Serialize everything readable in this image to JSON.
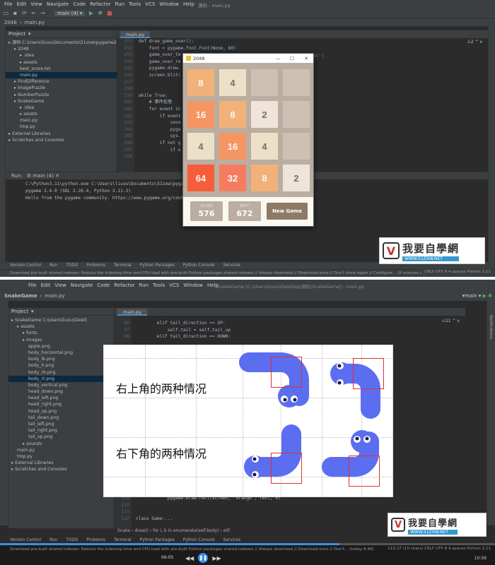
{
  "top_ide": {
    "menu": [
      "File",
      "Edit",
      "View",
      "Navigate",
      "Code",
      "Refactor",
      "Run",
      "Tools",
      "VCS",
      "Window",
      "Help"
    ],
    "window_title": "源码 - main.py",
    "run_config": "main (4)",
    "breadcrumb": [
      "2048",
      "main.py"
    ],
    "project_label": "Project",
    "editor_tab": "main.py",
    "tree": [
      {
        "text": "源码 C:\\Users\\liuxu\\Documents\\51zxw\\pygame2\\源码",
        "indent": 0
      },
      {
        "text": "2048",
        "indent": 1
      },
      {
        "text": ".idea",
        "indent": 2
      },
      {
        "text": "assets",
        "indent": 2
      },
      {
        "text": "best_score.txt",
        "indent": 2
      },
      {
        "text": "main.py",
        "indent": 2,
        "selected": true
      },
      {
        "text": "FindDifference",
        "indent": 1
      },
      {
        "text": "ImagePuzzle",
        "indent": 1
      },
      {
        "text": "NumberPuzzle",
        "indent": 1
      },
      {
        "text": "SnakeGame",
        "indent": 1
      },
      {
        "text": ".idea",
        "indent": 2
      },
      {
        "text": "assets",
        "indent": 2
      },
      {
        "text": "main.py",
        "indent": 2
      },
      {
        "text": "tmp.py",
        "indent": 2
      },
      {
        "text": "External Libraries",
        "indent": 0
      },
      {
        "text": "Scratches and Consoles",
        "indent": 0
      }
    ],
    "gutter": [
      "251",
      "252",
      "253",
      "254",
      "255",
      "256",
      "257",
      "258",
      "259",
      "260",
      "261",
      "262",
      "263",
      "264",
      "265",
      "266",
      "267",
      "268"
    ],
    "code": [
      "def draw_game_over():",
      "    font = pygame.font.Font(None, 60)",
      "    game_over_te",
      "    game_over_re",
      "    pygame.draw.",
      "    screen.blit(",
      "",
      "",
      "while True:",
      "    # 事件处理",
      "    for event in",
      "        if event",
      "            save",
      "            pyga",
      "            sys.",
      "        if not g",
      "            if e",
      ""
    ],
    "code_right_fragment": "Text')",
    "warning_badge": "⚠2 ^ v",
    "run_label": "Run:",
    "run_tab": "main (4)",
    "console": [
      "C:\\Python3.11\\python.exe C:\\Users\\liuxu\\Documents\\51zxw\\pyga",
      "pygame 2.4.0 (SDL 2.26.4, Python 3.11.3)",
      "Hello from the pygame community. https://www.pygame.org/cont"
    ],
    "console_link": "https://www.pygame.org/cont",
    "bottom_tabs": [
      "Version Control",
      "Run",
      "TODO",
      "Problems",
      "Terminal",
      "Python Packages",
      "Python Console",
      "Services"
    ],
    "status": "Download pre-built shared indexes: Reduce the indexing time and CPU load with pre-built Python packages shared indexes // Always download // Download once // Don't show again // Configure... (8 minutes ag",
    "status_right": "CRLF  UTF-8  4 spaces  Python 3.11"
  },
  "game2048": {
    "title": "2048",
    "tiles": [
      {
        "v": "8",
        "row": 0,
        "col": 0,
        "bg": "#f2b179",
        "fg": "#f9f6f2"
      },
      {
        "v": "4",
        "row": 0,
        "col": 1,
        "bg": "#ede0c8",
        "fg": "#776e65"
      },
      {
        "v": "",
        "row": 0,
        "col": 2,
        "bg": "#cdc1b4",
        "fg": "#776e65"
      },
      {
        "v": "",
        "row": 0,
        "col": 3,
        "bg": "#cdc1b4",
        "fg": "#776e65"
      },
      {
        "v": "16",
        "row": 1,
        "col": 0,
        "bg": "#f59563",
        "fg": "#f9f6f2"
      },
      {
        "v": "8",
        "row": 1,
        "col": 1,
        "bg": "#f2b179",
        "fg": "#f9f6f2"
      },
      {
        "v": "2",
        "row": 1,
        "col": 2,
        "bg": "#eee4da",
        "fg": "#776e65"
      },
      {
        "v": "",
        "row": 1,
        "col": 3,
        "bg": "#cdc1b4",
        "fg": "#776e65"
      },
      {
        "v": "4",
        "row": 2,
        "col": 0,
        "bg": "#ede0c8",
        "fg": "#776e65"
      },
      {
        "v": "16",
        "row": 2,
        "col": 1,
        "bg": "#f59563",
        "fg": "#f9f6f2"
      },
      {
        "v": "4",
        "row": 2,
        "col": 2,
        "bg": "#ede0c8",
        "fg": "#776e65"
      },
      {
        "v": "",
        "row": 2,
        "col": 3,
        "bg": "#cdc1b4",
        "fg": "#776e65"
      },
      {
        "v": "64",
        "row": 3,
        "col": 0,
        "bg": "#f65e3b",
        "fg": "#f9f6f2"
      },
      {
        "v": "32",
        "row": 3,
        "col": 1,
        "bg": "#f67c5f",
        "fg": "#f9f6f2"
      },
      {
        "v": "8",
        "row": 3,
        "col": 2,
        "bg": "#f2b179",
        "fg": "#f9f6f2"
      },
      {
        "v": "2",
        "row": 3,
        "col": 3,
        "bg": "#eee4da",
        "fg": "#776e65"
      }
    ],
    "score_label": "SCORE",
    "score": "576",
    "best_label": "BEST",
    "best": "672",
    "new_game": "New Game"
  },
  "watermark": {
    "title": "我要自學網",
    "url": "WWW.51ZXW.NET"
  },
  "bottom_ide": {
    "window_title": "SnakeGame [C:\\Users\\liuxu\\Desktop\\源码\\SnakeGame] - main.py",
    "project_crumb": [
      "SnakeGame",
      "main.py"
    ],
    "run_config": "main",
    "project_label": "Project",
    "editor_tab": "main.py",
    "tree": [
      {
        "text": "SnakeGame C:\\Users\\liuxu\\Deskt",
        "indent": 0
      },
      {
        "text": "assets",
        "indent": 1
      },
      {
        "text": "fonts",
        "indent": 2
      },
      {
        "text": "images",
        "indent": 2
      },
      {
        "text": "apple.png",
        "indent": 3
      },
      {
        "text": "body_horizontal.png",
        "indent": 3
      },
      {
        "text": "body_lb.png",
        "indent": 3
      },
      {
        "text": "body_lt.png",
        "indent": 3
      },
      {
        "text": "body_rb.png",
        "indent": 3
      },
      {
        "text": "body_rt.png",
        "indent": 3,
        "selected": true
      },
      {
        "text": "body_vertical.png",
        "indent": 3
      },
      {
        "text": "head_down.png",
        "indent": 3
      },
      {
        "text": "head_left.png",
        "indent": 3
      },
      {
        "text": "head_right.png",
        "indent": 3
      },
      {
        "text": "head_up.png",
        "indent": 3
      },
      {
        "text": "tail_down.png",
        "indent": 3
      },
      {
        "text": "tail_left.png",
        "indent": 3
      },
      {
        "text": "tail_right.png",
        "indent": 3
      },
      {
        "text": "tail_up.png",
        "indent": 3
      },
      {
        "text": "sounds",
        "indent": 2
      },
      {
        "text": "main.py",
        "indent": 1
      },
      {
        "text": "tmp.py",
        "indent": 1
      },
      {
        "text": "External Libraries",
        "indent": 0
      },
      {
        "text": "Scratches and Consoles",
        "indent": 0
      }
    ],
    "gutter_top": [
      "96",
      "97",
      "98"
    ],
    "code_top": [
      "        elif tail_direction == UP:",
      "            self.tail = self.tail_up",
      "        elif tail_direction == DOWN:"
    ],
    "gutter_bottom": [
      "119",
      "120",
      "121",
      "122"
    ],
    "code_bottom": [
      "            pygame.draw.rect(screen, 'orange', rect, 0)",
      "",
      "",
      "class Game:..."
    ],
    "warning_badge": "⚠11 ^ v",
    "breadcrumb_bottom": "Snake  ›  draw()  ›  for i, b in enumerate(self.body)  ›  elif",
    "bottom_tabs": [
      "Version Control",
      "Run",
      "TODO",
      "Problems",
      "Terminal",
      "Python Packages",
      "Python Console",
      "Services"
    ],
    "status": "Download pre-built shared indexes: Reduce the indexing time and CPU load with pre-built Python packages shared indexes // Always download // Download once // Don't... (today 8:46)",
    "status_right": "113:27 (10 chars)  CRLF  UTF-8  4 spaces  Python 3.11",
    "right_panel": "Notifications"
  },
  "slide": {
    "text_top": "右上角的两种情况",
    "text_bottom": "右下角的两种情况",
    "snake_color": "#5b6ef0"
  },
  "player": {
    "time": "06:05",
    "clock": "10:56"
  }
}
